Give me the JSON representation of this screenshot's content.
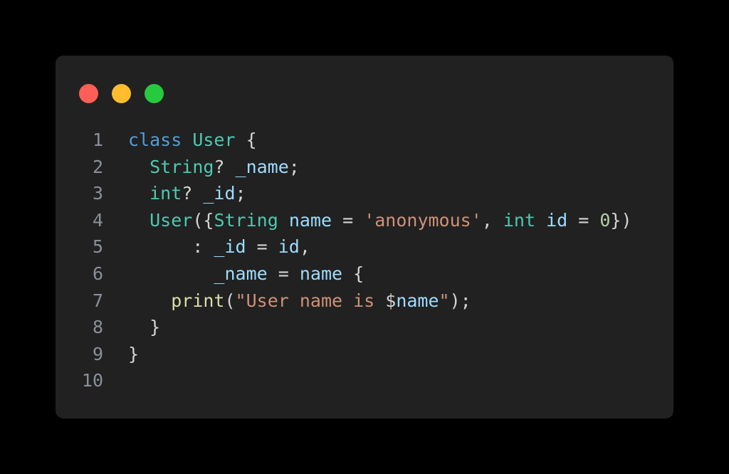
{
  "window": {
    "background_color": "#000000",
    "panel_color": "#212121",
    "controls": [
      {
        "name": "close",
        "label": "Close",
        "color": "#ff5f56"
      },
      {
        "name": "minimize",
        "label": "Minimize",
        "color": "#ffbd2e"
      },
      {
        "name": "maximize",
        "label": "Maximize",
        "color": "#27c93f"
      }
    ]
  },
  "editor": {
    "language": "Dart",
    "theme_colors": {
      "keyword": "#569cd6",
      "type": "#4ec9b0",
      "variable": "#9cdcfe",
      "string": "#ce9178",
      "number": "#b5cea8",
      "function": "#dcdcaa",
      "punctuation": "#d4d4d4",
      "line_number": "#8a8f99"
    },
    "line_numbers": [
      "1",
      "2",
      "3",
      "4",
      "5",
      "6",
      "7",
      "8",
      "9",
      "10"
    ],
    "lines": [
      {
        "number": "1",
        "text": "class User {",
        "tokens": [
          {
            "t": "class",
            "c": "keyword"
          },
          {
            "t": " ",
            "c": "plain"
          },
          {
            "t": "User",
            "c": "type"
          },
          {
            "t": " {",
            "c": "punct"
          }
        ]
      },
      {
        "number": "2",
        "text": "  String? _name;",
        "tokens": [
          {
            "t": "  ",
            "c": "plain"
          },
          {
            "t": "String",
            "c": "type"
          },
          {
            "t": "? ",
            "c": "punct"
          },
          {
            "t": "_name",
            "c": "var"
          },
          {
            "t": ";",
            "c": "punct"
          }
        ]
      },
      {
        "number": "3",
        "text": "  int? _id;",
        "tokens": [
          {
            "t": "  ",
            "c": "plain"
          },
          {
            "t": "int",
            "c": "type"
          },
          {
            "t": "? ",
            "c": "punct"
          },
          {
            "t": "_id",
            "c": "var"
          },
          {
            "t": ";",
            "c": "punct"
          }
        ]
      },
      {
        "number": "4",
        "text": "  User({String name = 'anonymous', int id = 0})",
        "tokens": [
          {
            "t": "  ",
            "c": "plain"
          },
          {
            "t": "User",
            "c": "type"
          },
          {
            "t": "({",
            "c": "punct"
          },
          {
            "t": "String",
            "c": "type"
          },
          {
            "t": " ",
            "c": "plain"
          },
          {
            "t": "name",
            "c": "var"
          },
          {
            "t": " = ",
            "c": "punct"
          },
          {
            "t": "'anonymous'",
            "c": "string"
          },
          {
            "t": ", ",
            "c": "punct"
          },
          {
            "t": "int",
            "c": "type"
          },
          {
            "t": " ",
            "c": "plain"
          },
          {
            "t": "id",
            "c": "var"
          },
          {
            "t": " = ",
            "c": "punct"
          },
          {
            "t": "0",
            "c": "number"
          },
          {
            "t": "})",
            "c": "punct"
          }
        ]
      },
      {
        "number": "5",
        "text": "      : _id = id,",
        "tokens": [
          {
            "t": "      : ",
            "c": "punct"
          },
          {
            "t": "_id",
            "c": "var"
          },
          {
            "t": " = ",
            "c": "punct"
          },
          {
            "t": "id",
            "c": "var"
          },
          {
            "t": ",",
            "c": "punct"
          }
        ]
      },
      {
        "number": "6",
        "text": "        _name = name {",
        "tokens": [
          {
            "t": "        ",
            "c": "plain"
          },
          {
            "t": "_name",
            "c": "var"
          },
          {
            "t": " = ",
            "c": "punct"
          },
          {
            "t": "name",
            "c": "var"
          },
          {
            "t": " {",
            "c": "punct"
          }
        ]
      },
      {
        "number": "7",
        "text": "    print(\"User name is $name\");",
        "tokens": [
          {
            "t": "    ",
            "c": "plain"
          },
          {
            "t": "print",
            "c": "func"
          },
          {
            "t": "(",
            "c": "punct"
          },
          {
            "t": "\"User name is ",
            "c": "string"
          },
          {
            "t": "$",
            "c": "punct"
          },
          {
            "t": "name",
            "c": "var"
          },
          {
            "t": "\"",
            "c": "string"
          },
          {
            "t": ");",
            "c": "punct"
          }
        ]
      },
      {
        "number": "8",
        "text": "  }",
        "tokens": [
          {
            "t": "  }",
            "c": "punct"
          }
        ]
      },
      {
        "number": "9",
        "text": "}",
        "tokens": [
          {
            "t": "}",
            "c": "punct"
          }
        ]
      },
      {
        "number": "10",
        "text": "",
        "tokens": []
      }
    ]
  }
}
